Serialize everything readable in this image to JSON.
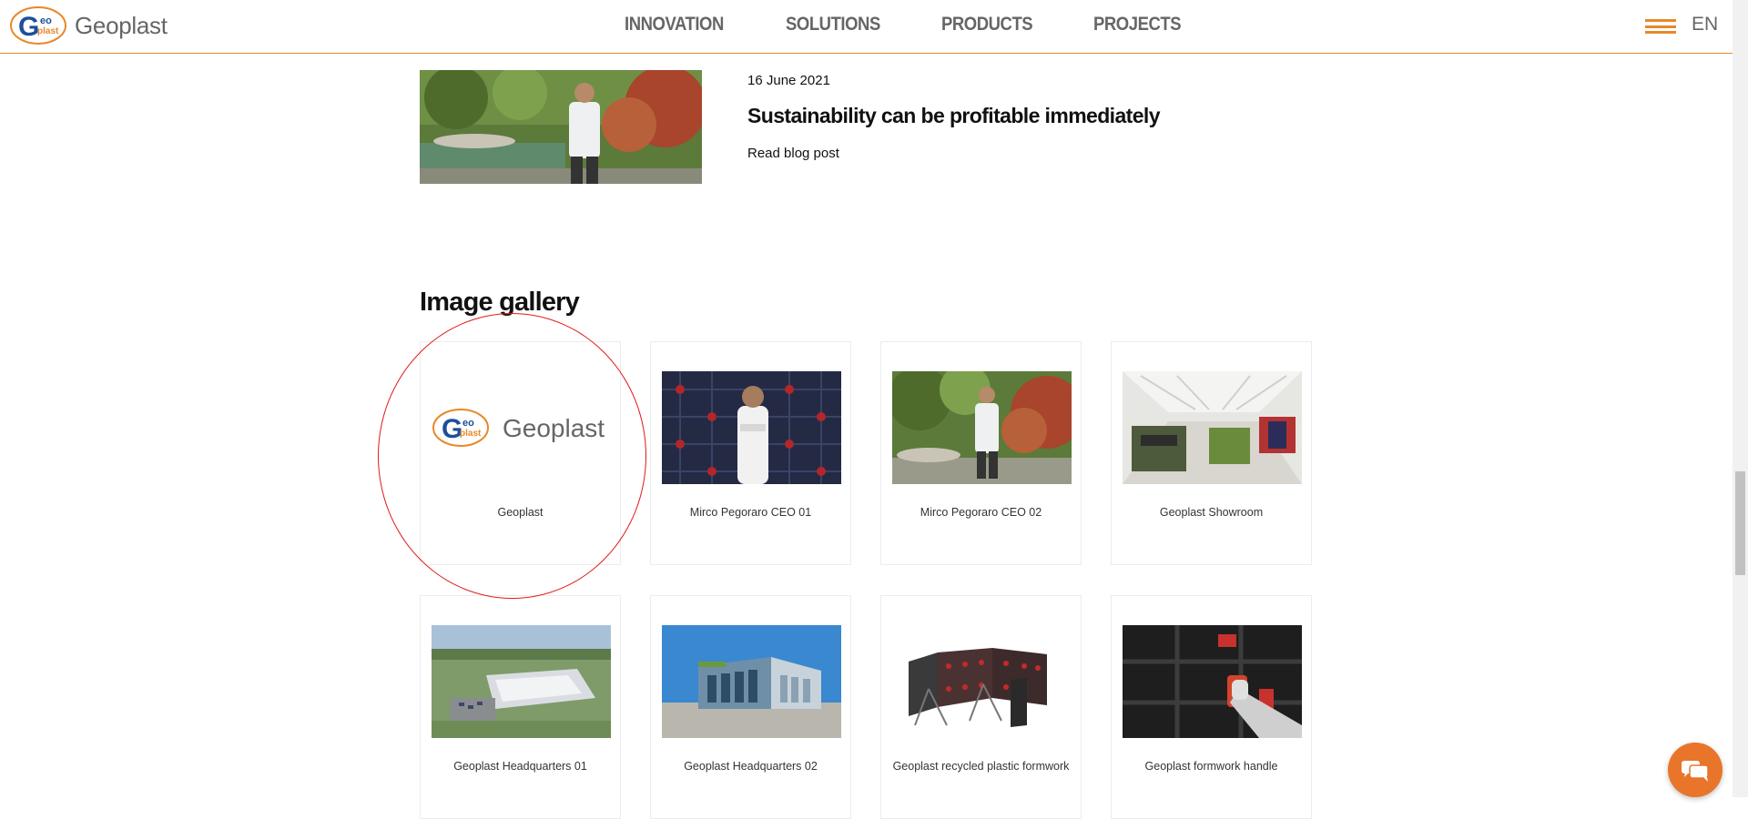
{
  "header": {
    "logo_text": "Geoplast",
    "nav": [
      "INNOVATION",
      "SOLUTIONS",
      "PRODUCTS",
      "PROJECTS"
    ],
    "lang": "EN",
    "accent": "#e8882a"
  },
  "blog": {
    "date": "16 June 2021",
    "title": "Sustainability can be profitable immediately",
    "link": "Read blog post"
  },
  "gallery": {
    "title": "Image gallery",
    "items": [
      {
        "caption": "Geoplast",
        "logo_text": "Geoplast"
      },
      {
        "caption": "Mirco Pegoraro CEO 01"
      },
      {
        "caption": "Mirco Pegoraro CEO 02"
      },
      {
        "caption": "Geoplast Showroom"
      },
      {
        "caption": "Geoplast Headquarters 01"
      },
      {
        "caption": "Geoplast Headquarters 02"
      },
      {
        "caption": "Geoplast recycled plastic formwork"
      },
      {
        "caption": "Geoplast formwork handle"
      }
    ]
  },
  "icons": {
    "menu": "hamburger-menu-icon",
    "chat": "chat-bubble-icon"
  }
}
